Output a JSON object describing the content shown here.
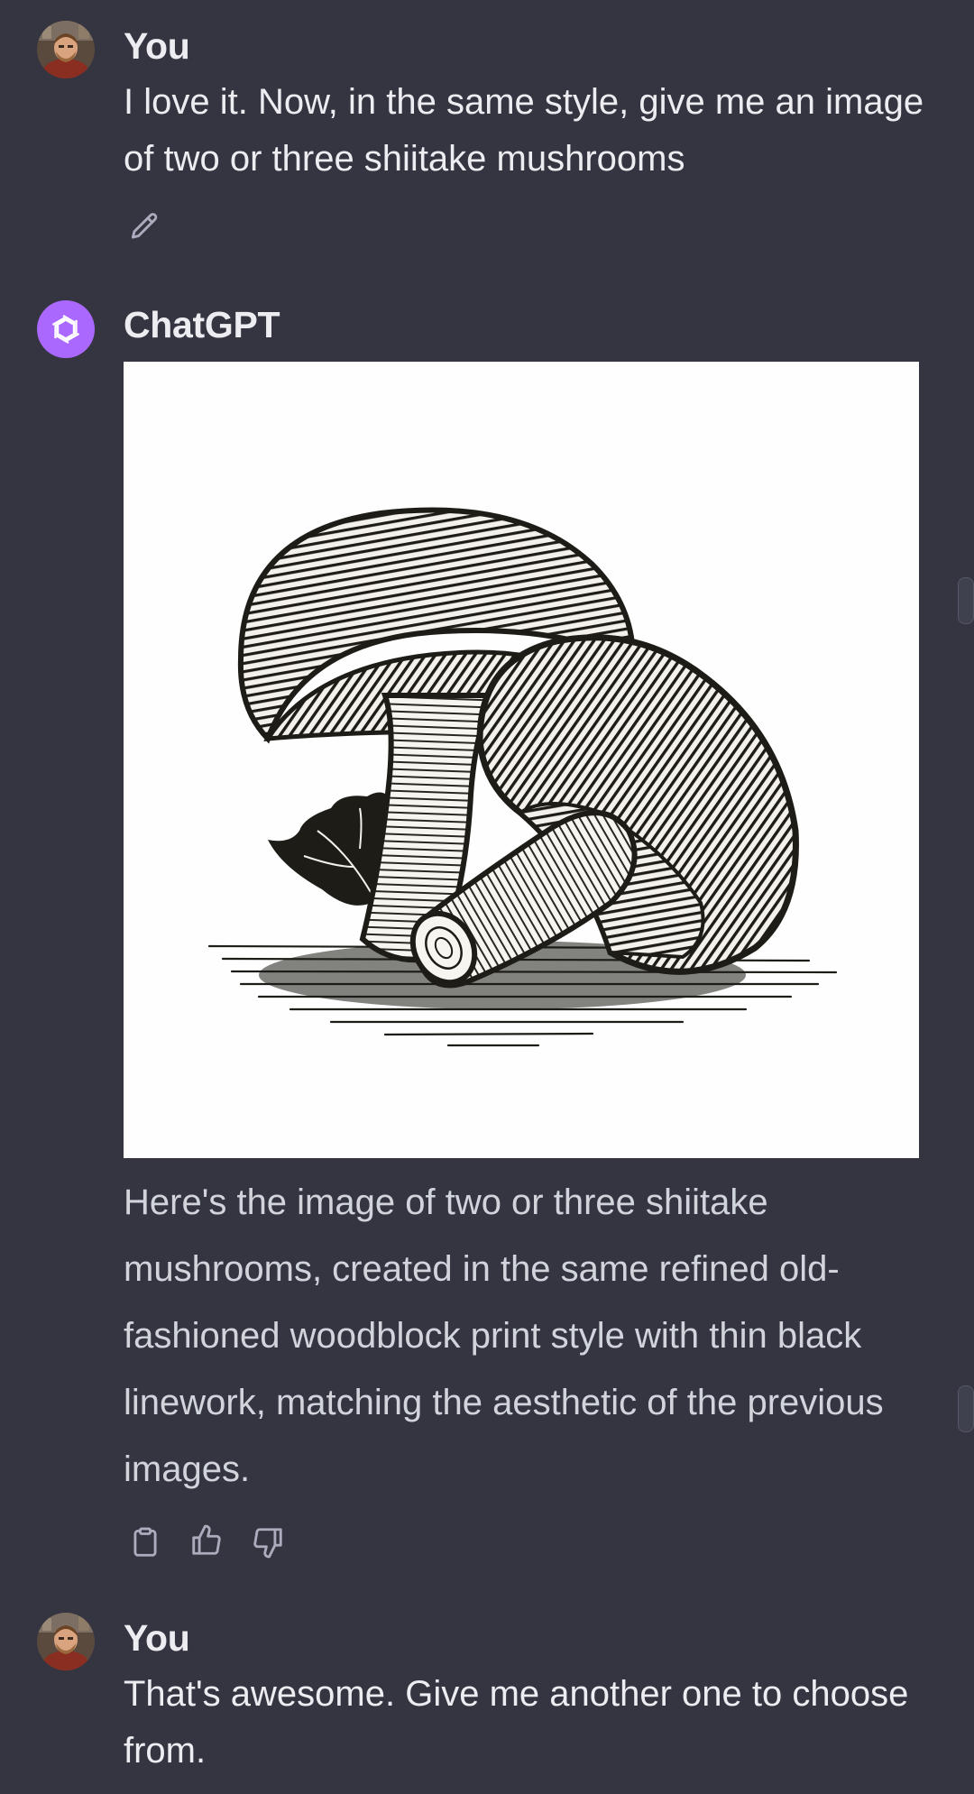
{
  "conversation": [
    {
      "role": "user",
      "author": "You",
      "text": "I love it.  Now, in the same style, give me an image of two or three shiitake mushrooms",
      "actions": [
        "edit-icon"
      ]
    },
    {
      "role": "assistant",
      "author": "ChatGPT",
      "image_alt": "Woodblock print style illustration of shiitake mushrooms",
      "text": "Here's the image of two or three shiitake mushrooms, created in the same refined old-fashioned woodblock print style with thin black linework, matching the aesthetic of the previous images.",
      "actions": [
        "copy-icon",
        "thumbs-up-icon",
        "thumbs-down-icon"
      ]
    },
    {
      "role": "user",
      "author": "You",
      "text": "That's awesome.  Give me another one to choose from."
    }
  ],
  "colors": {
    "background": "#343541",
    "text_primary": "#ececf1",
    "text_assistant": "#d1d5db",
    "chatgpt_avatar": "#ab68ff",
    "icon": "#acacbe"
  }
}
